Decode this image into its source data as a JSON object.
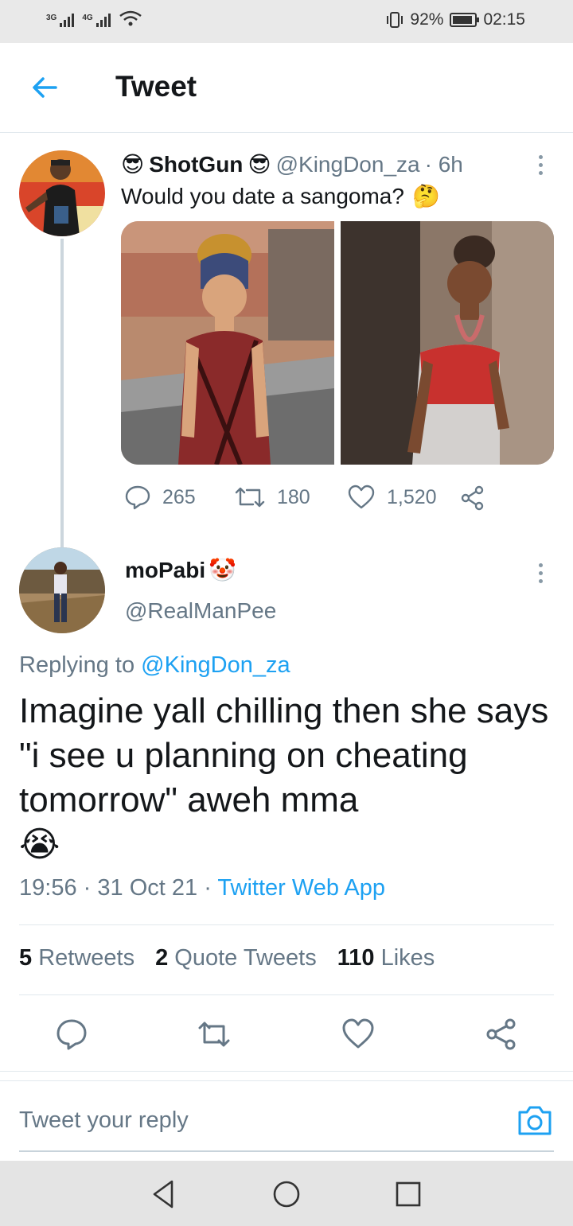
{
  "status_bar": {
    "network_1": "3G",
    "network_2": "4G",
    "battery_pct": "92%",
    "battery_level": 0.92,
    "time": "02:15"
  },
  "header": {
    "title": "Tweet",
    "back_icon": "arrow-left-icon"
  },
  "tweet": {
    "display_name": "ShotGun",
    "name_emoji": "😎",
    "handle": "@KingDon_za",
    "age": "· 6h",
    "text": "Would you date a sangoma?",
    "text_emoji": "🤔",
    "replies": "265",
    "retweets": "180",
    "likes": "1,520"
  },
  "reply": {
    "display_name": "moPabi",
    "name_emoji": "🤡",
    "handle": "@RealManPee",
    "replying_label": "Replying to",
    "replying_handle": "@KingDon_za",
    "text": "Imagine yall chilling then she says \"i see u planning on cheating tomorrow\" aweh mma",
    "text_emoji": "😭",
    "time": "19:56",
    "dot": "·",
    "date": "31 Oct 21",
    "source": "Twitter Web App",
    "retweets_count": "5",
    "retweets_label": "Retweets",
    "quote_count": "2",
    "quote_label": "Quote Tweets",
    "likes_count": "110",
    "likes_label": "Likes"
  },
  "composer": {
    "placeholder": "Tweet your reply"
  },
  "colors": {
    "accent": "#1da1f2",
    "muted": "#657786",
    "divider": "#e1e8ed"
  }
}
